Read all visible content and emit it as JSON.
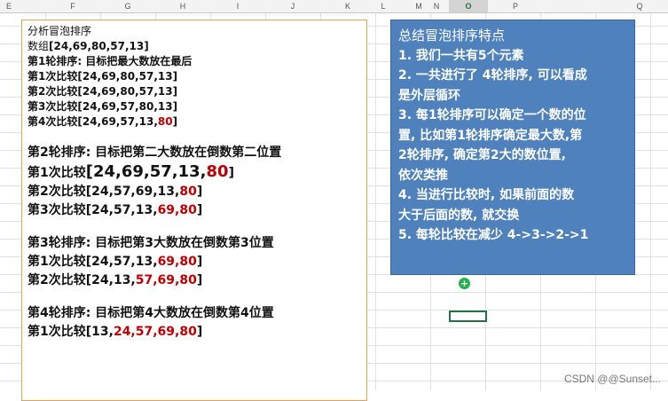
{
  "columns": [
    "E",
    "F",
    "G",
    "H",
    "I",
    "J",
    "K",
    "L",
    "M",
    "N",
    "O",
    "P",
    "Q"
  ],
  "active_column": "O",
  "left_box": {
    "title": "分析冒泡排序",
    "array_prefix": "数组",
    "array_value": "[24,69,80,57,13]",
    "round1": {
      "heading": "第1轮排序: 目标把最大数放在最后",
      "rows": [
        {
          "label": "第1次比较",
          "text": "[24,69,80,57,13]",
          "red": "",
          "tail": ""
        },
        {
          "label": "第2次比较",
          "text": "[24,69,80,57,13]",
          "red": "",
          "tail": ""
        },
        {
          "label": "第3次比较",
          "text": "[24,69,57,80,13]",
          "red": "",
          "tail": ""
        },
        {
          "label": "第4次比较",
          "text": "[24,69,57,13,",
          "red": "80",
          "tail": "]"
        }
      ]
    },
    "round2": {
      "heading": "第2轮排序: 目标把第二大数放在倒数第二位置",
      "row1": {
        "label": "第1次比较",
        "text": "[24,69,57,13,",
        "red": "80",
        "tail": "]"
      },
      "rows": [
        {
          "label": "第2次比较",
          "text": "[24,57,69,13,",
          "red": "80",
          "tail": "]"
        },
        {
          "label": "第3次比较",
          "text": "[24,57,13,",
          "red": "69,80",
          "tail": "]"
        }
      ]
    },
    "round3": {
      "heading": "第3轮排序: 目标把第3大数放在倒数第3位置",
      "rows": [
        {
          "label": "第1次比较",
          "text": "[24,57,13,",
          "red": "69,80",
          "tail": "]"
        },
        {
          "label": "第2次比较",
          "text": "[24,13,",
          "red": "57,69,80",
          "tail": "]"
        }
      ]
    },
    "round4": {
      "heading": "第4轮排序: 目标把第4大数放在倒数第4位置",
      "rows": [
        {
          "label": "第1次比较",
          "text": "[13,",
          "red": "24,57,69,80",
          "tail": "]"
        }
      ]
    }
  },
  "right_box": {
    "title": "总结冒泡排序特点",
    "lines": [
      "1. 我们一共有5个元素",
      "2. 一共进行了 4轮排序, 可以看成",
      "是外层循环",
      "3. 每1轮排序可以确定一个数的位",
      "置, 比如第1轮排序确定最大数,第",
      "2轮排序, 确定第2大的数位置,",
      "依次类推",
      "4. 当进行比较时, 如果前面的数",
      "大于后面的数, 就交换",
      "5. 每轮比较在减少 4->3->2->1"
    ]
  },
  "cursor_glyph": "+",
  "watermark": "CSDN @@Sunset..."
}
